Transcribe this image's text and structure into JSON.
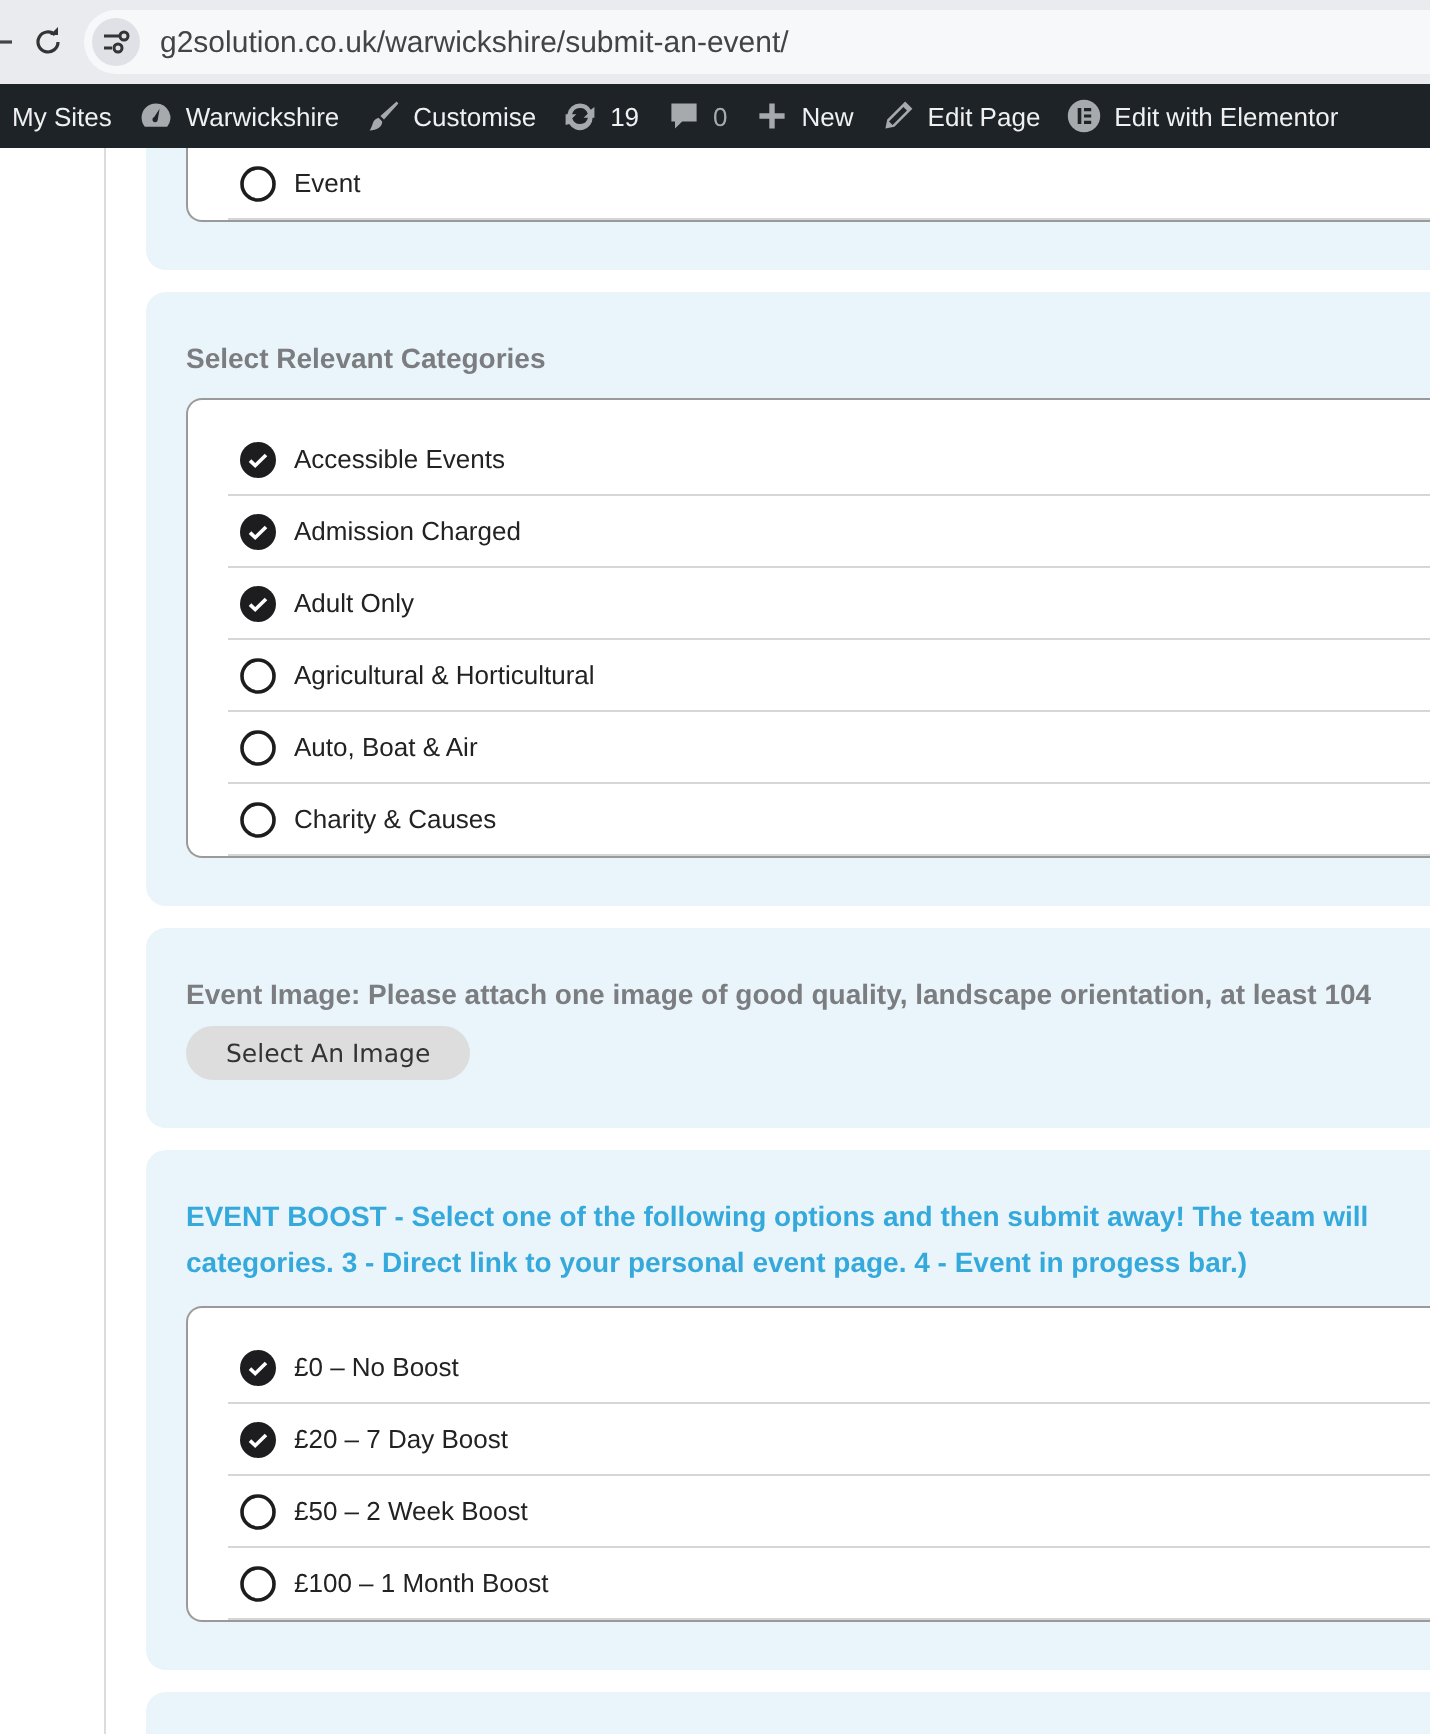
{
  "browser": {
    "url": "g2solution.co.uk/warwickshire/submit-an-event/"
  },
  "admin_bar": [
    {
      "kind": "text",
      "label": "My Sites"
    },
    {
      "kind": "gauge",
      "label": "Warwickshire"
    },
    {
      "kind": "brush",
      "label": "Customise"
    },
    {
      "kind": "refresh",
      "label": "19"
    },
    {
      "kind": "comment",
      "label": "0"
    },
    {
      "kind": "plus",
      "label": "New"
    },
    {
      "kind": "pencil",
      "label": "Edit Page"
    },
    {
      "kind": "elementor",
      "label": "Edit with Elementor"
    }
  ],
  "sections": [
    {
      "kind": "list",
      "options": [
        {
          "label": "Event",
          "checked": false
        }
      ]
    },
    {
      "kind": "list",
      "title": "Select Relevant Categories",
      "options": [
        {
          "label": "Accessible Events",
          "checked": true
        },
        {
          "label": "Admission Charged",
          "checked": true
        },
        {
          "label": "Adult Only",
          "checked": true
        },
        {
          "label": "Agricultural & Horticultural",
          "checked": false
        },
        {
          "label": "Auto, Boat & Air",
          "checked": false
        },
        {
          "label": "Charity & Causes",
          "checked": false
        }
      ]
    },
    {
      "kind": "upload",
      "title": "Event Image: Please attach one image of good quality, landscape orientation, at least 104",
      "button": "Select An Image"
    },
    {
      "kind": "list",
      "accent": true,
      "title_lines": [
        "EVENT BOOST - Select one of the following options and then submit away! The team will",
        "categories. 3 - Direct link to your personal event page. 4 - Event in progess bar.)"
      ],
      "options": [
        {
          "label": "£0 – No Boost",
          "checked": true
        },
        {
          "label": "£20 – 7 Day Boost",
          "checked": true
        },
        {
          "label": "£50 – 2 Week Boost",
          "checked": false
        },
        {
          "label": "£100 – 1 Month Boost",
          "checked": false
        }
      ]
    },
    {
      "kind": "empty"
    }
  ]
}
